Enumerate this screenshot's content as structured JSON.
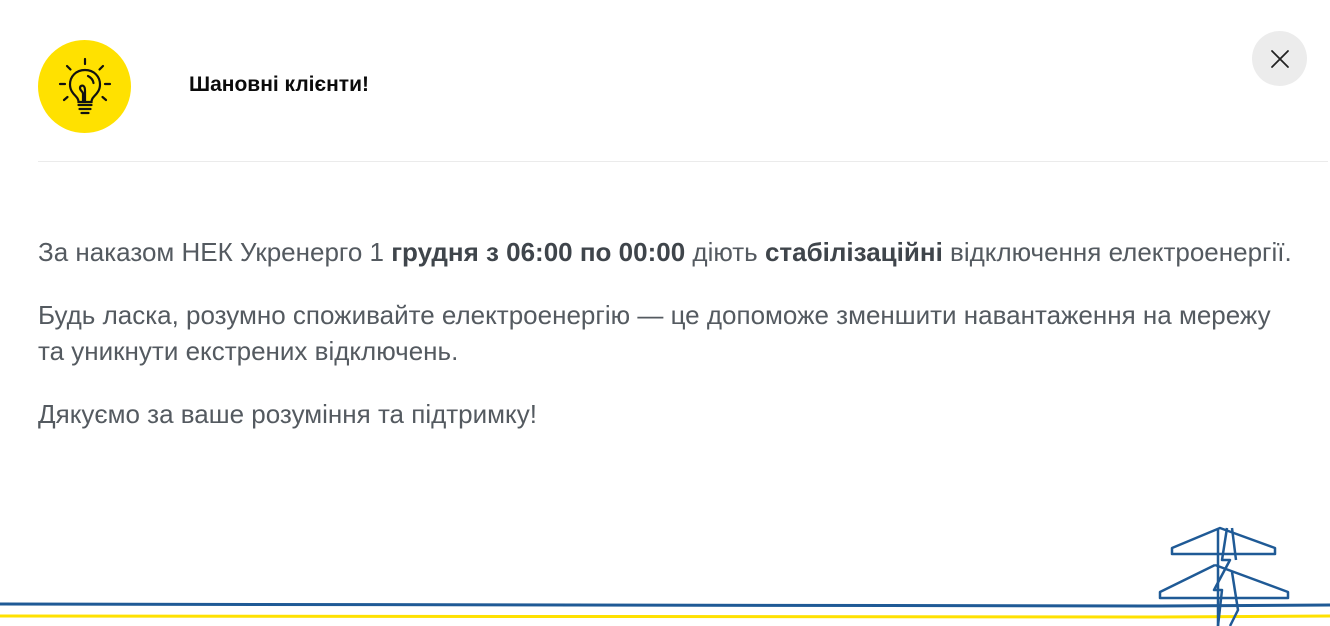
{
  "header": {
    "title": "Шановні клієнти!",
    "icon": "lightbulb-icon",
    "icon_bg": "#ffe100"
  },
  "close": {
    "icon": "close-icon"
  },
  "message": {
    "p1": {
      "t1": "За наказом НЕК Укренерго 1 ",
      "b1": "грудня з 06:00 по 00:00",
      "t2": " діють ",
      "b2": "стабілізаційні",
      "t3": " відключення електроенергії."
    },
    "p2": "Будь ласка, розумно споживайте електроенергію — це допоможе зменшити навантаження на мережу та уникнути екстрених відключень.",
    "p3": "Дякуємо за ваше розуміння та підтримку!"
  },
  "footer": {
    "icon": "power-line-tower-icon",
    "line_colors": [
      "#1f5a96",
      "#ffe100"
    ]
  }
}
